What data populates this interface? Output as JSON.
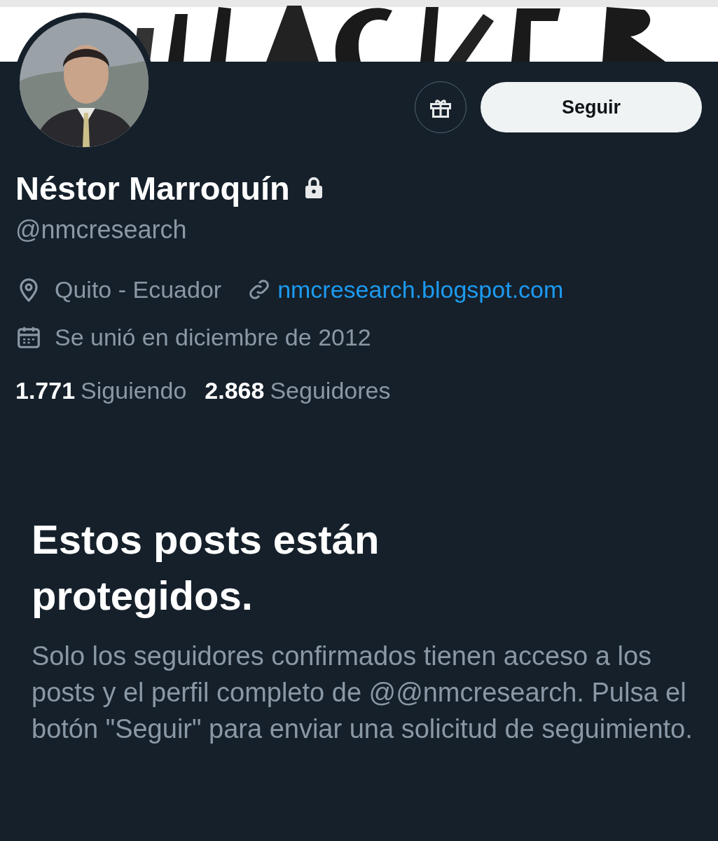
{
  "actions": {
    "follow_button": "Seguir"
  },
  "profile": {
    "name": "Néstor Marroquín",
    "protected": true,
    "handle": "@nmcresearch",
    "location": "Quito - Ecuador",
    "website": "nmcresearch.blogspot.com",
    "joined": "Se unió en diciembre de 2012"
  },
  "stats": [
    {
      "count": "1.771",
      "label": "Siguiendo"
    },
    {
      "count": "2.868",
      "label": "Seguidores"
    }
  ],
  "protected_notice": {
    "title": "Estos posts están protegidos.",
    "message": "Solo los seguidores confirmados tienen acceso a los posts y el perfil completo de @@nmcresearch. Pulsa el botón \"Seguir\" para enviar una solicitud de seguimiento."
  }
}
